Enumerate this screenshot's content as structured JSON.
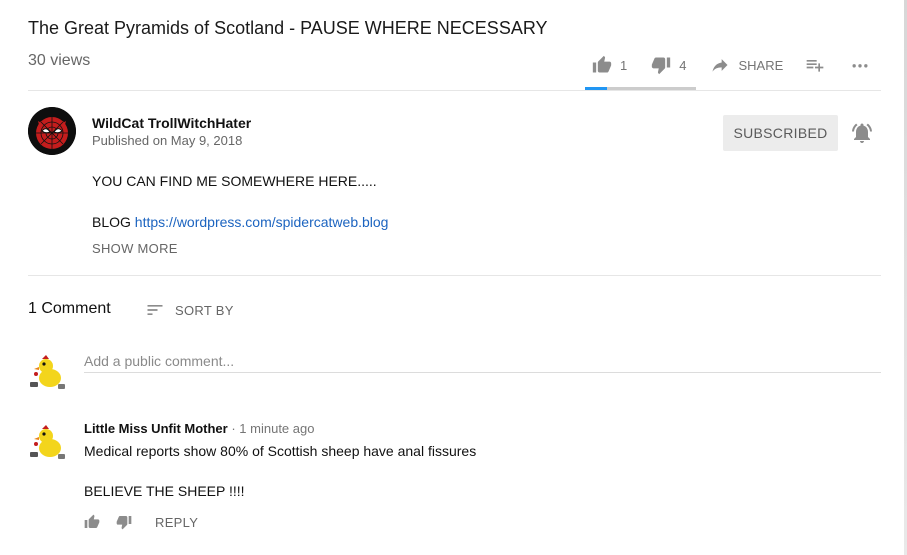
{
  "video": {
    "title": "The Great Pyramids of Scotland - PAUSE WHERE NECESSARY",
    "views": "30 views",
    "likes": "1",
    "dislikes": "4",
    "share_label": "SHARE",
    "like_ratio": 0.2
  },
  "channel": {
    "name": "WildCat TrollWitchHater",
    "published": "Published on May 9, 2018",
    "subscribe_label": "SUBSCRIBED"
  },
  "description": {
    "line1": "YOU CAN FIND ME SOMEWHERE HERE.....",
    "blog_label": "BLOG",
    "blog_url": "https://wordpress.com/spidercatweb.blog",
    "show_more": "SHOW MORE"
  },
  "comments": {
    "count_label": "1 Comment",
    "sort_label": "SORT BY",
    "input_placeholder": "Add a public comment...",
    "items": [
      {
        "author": "Little Miss Unfit Mother",
        "time": "1 minute ago",
        "text_line1": "Medical reports show 80% of Scottish sheep have anal fissures",
        "text_line2": "BELIEVE THE SHEEP !!!!",
        "reply_label": "REPLY"
      }
    ]
  },
  "colors": {
    "accent_blue": "#2196f3",
    "link_blue": "#1c64c0",
    "subscribed_bg": "#ececec"
  },
  "icons": [
    "thumb-up-icon",
    "thumb-down-icon",
    "share-icon",
    "add-to-playlist-icon",
    "more-icon",
    "bell-icon",
    "sort-icon"
  ]
}
